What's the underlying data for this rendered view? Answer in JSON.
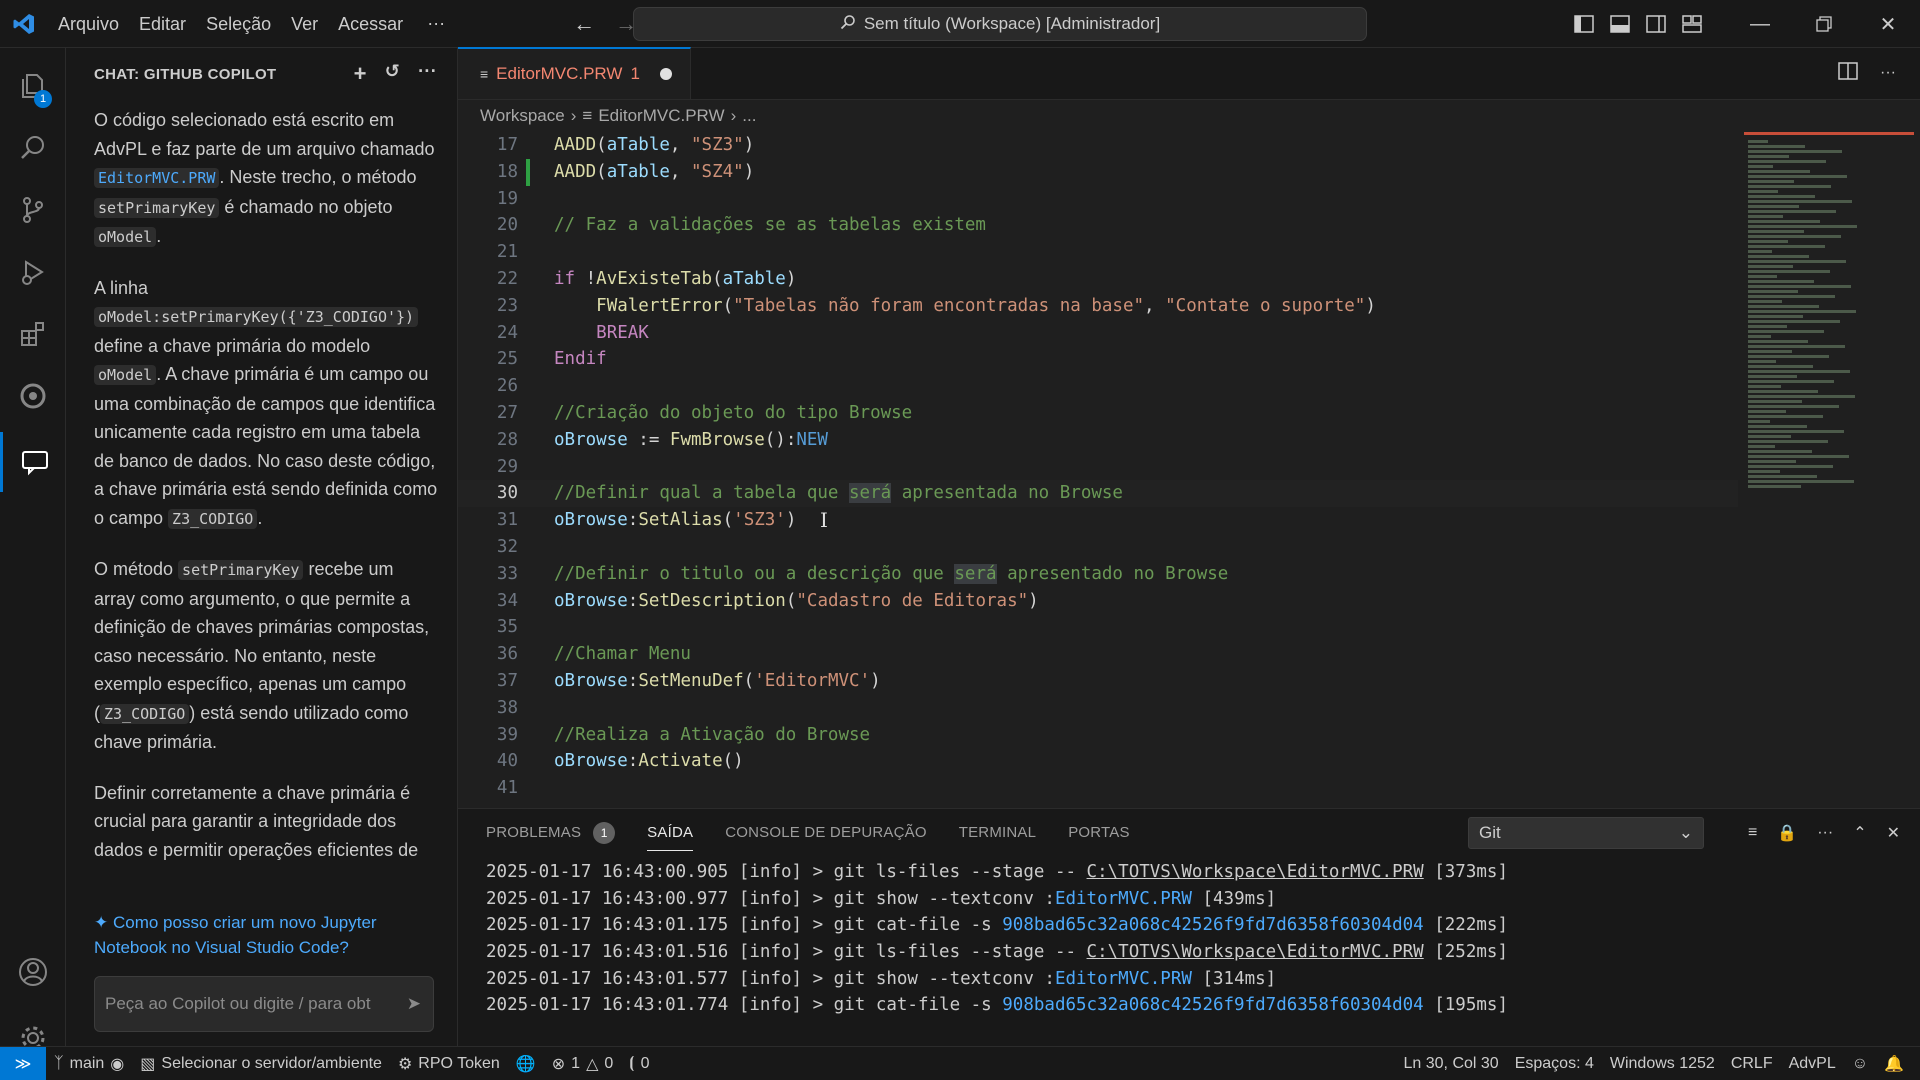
{
  "menu": {
    "items": [
      "Arquivo",
      "Editar",
      "Seleção",
      "Ver",
      "Acessar"
    ],
    "more": "···"
  },
  "command_center": {
    "label": "Sem título (Workspace) [Administrador]"
  },
  "activity": {
    "explorer_badge": "1"
  },
  "chat": {
    "header": "CHAT: GITHUB COPILOT",
    "p1": {
      "a": "O código selecionado está escrito em AdvPL e faz parte de um arquivo chamado ",
      "file": "EditorMVC.PRW",
      "b": ". Neste trecho, o método ",
      "method": "setPrimaryKey",
      "c": " é chamado no objeto ",
      "obj": "oModel",
      "d": "."
    },
    "p2": {
      "a": "A linha ",
      "code": "oModel:setPrimaryKey({'Z3_CODIGO'})",
      "b": " define a chave primária do modelo ",
      "obj": "oModel",
      "c": ". A chave primária é um campo ou uma combinação de campos que identifica unicamente cada registro em uma tabela de banco de dados. No caso deste código, a chave primária está sendo definida como o campo ",
      "field": "Z3_CODIGO",
      "d": "."
    },
    "p3": {
      "a": "O método ",
      "method": "setPrimaryKey",
      "b": " recebe um array como argumento, o que permite a definição de chaves primárias compostas, caso necessário. No entanto, neste exemplo específico, apenas um campo (",
      "field": "Z3_CODIGO",
      "c": ") está sendo utilizado como chave primária."
    },
    "p4": "Definir corretamente a chave primária é crucial para garantir a integridade dos dados e permitir operações eficientes de",
    "suggestion": "Como posso criar um novo Jupyter Notebook no Visual Studio Code?",
    "input_placeholder": "Peça ao Copilot ou digite / para obt"
  },
  "editor": {
    "tab": {
      "label": "EditorMVC.PRW",
      "problems": "1"
    },
    "breadcrumb": [
      "Workspace",
      "EditorMVC.PRW",
      "..."
    ]
  },
  "code_lines": [
    {
      "n": "17",
      "tokens": [
        [
          "fn",
          "AADD"
        ],
        [
          "p",
          "("
        ],
        [
          "var",
          "aTable"
        ],
        [
          "p",
          ", "
        ],
        [
          "str",
          "\"SZ3\""
        ],
        [
          "p",
          ")"
        ]
      ]
    },
    {
      "n": "18",
      "tokens": [
        [
          "fn",
          "AADD"
        ],
        [
          "p",
          "("
        ],
        [
          "var",
          "aTable"
        ],
        [
          "p",
          ", "
        ],
        [
          "str",
          "\"SZ4\""
        ],
        [
          "p",
          ")"
        ]
      ]
    },
    {
      "n": "19",
      "tokens": []
    },
    {
      "n": "20",
      "tokens": [
        [
          "cmt",
          "// Faz a validações se as tabelas existem"
        ]
      ]
    },
    {
      "n": "21",
      "tokens": []
    },
    {
      "n": "22",
      "tokens": [
        [
          "kw",
          "if"
        ],
        [
          "p",
          " !"
        ],
        [
          "fn",
          "AvExisteTab"
        ],
        [
          "p",
          "("
        ],
        [
          "var",
          "aTable"
        ],
        [
          "p",
          ")"
        ]
      ]
    },
    {
      "n": "23",
      "tokens": [
        [
          "p",
          "    "
        ],
        [
          "fn",
          "FWalertError"
        ],
        [
          "p",
          "("
        ],
        [
          "str",
          "\"Tabelas não foram encontradas na base\""
        ],
        [
          "p",
          ", "
        ],
        [
          "str",
          "\"Contate o suporte\""
        ],
        [
          "p",
          ")"
        ]
      ]
    },
    {
      "n": "24",
      "tokens": [
        [
          "p",
          "    "
        ],
        [
          "kw",
          "BREAK"
        ]
      ]
    },
    {
      "n": "25",
      "tokens": [
        [
          "kw",
          "Endif"
        ]
      ]
    },
    {
      "n": "26",
      "tokens": []
    },
    {
      "n": "27",
      "tokens": [
        [
          "cmt",
          "//Criação do objeto do tipo Browse"
        ]
      ]
    },
    {
      "n": "28",
      "tokens": [
        [
          "var",
          "oBrowse"
        ],
        [
          "p",
          " := "
        ],
        [
          "fn",
          "FwmBrowse"
        ],
        [
          "p",
          "():"
        ],
        [
          "k2",
          "NEW"
        ]
      ]
    },
    {
      "n": "29",
      "tokens": []
    },
    {
      "n": "30",
      "tokens": [
        [
          "cmt",
          "//Definir qual a tabela que "
        ],
        [
          "cmthl",
          "será"
        ],
        [
          "cmt",
          " apresentada no Browse"
        ]
      ]
    },
    {
      "n": "31",
      "tokens": [
        [
          "var",
          "oBrowse"
        ],
        [
          "p",
          ":"
        ],
        [
          "fn",
          "SetAlias"
        ],
        [
          "p",
          "("
        ],
        [
          "str",
          "'SZ3'"
        ],
        [
          "p",
          ")"
        ]
      ]
    },
    {
      "n": "32",
      "tokens": []
    },
    {
      "n": "33",
      "tokens": [
        [
          "cmt",
          "//Definir o titulo ou a descrição que "
        ],
        [
          "cmthl",
          "será"
        ],
        [
          "cmt",
          " apresentado no Browse"
        ]
      ]
    },
    {
      "n": "34",
      "tokens": [
        [
          "var",
          "oBrowse"
        ],
        [
          "p",
          ":"
        ],
        [
          "fn",
          "SetDescription"
        ],
        [
          "p",
          "("
        ],
        [
          "str",
          "\"Cadastro de Editoras\""
        ],
        [
          "p",
          ")"
        ]
      ]
    },
    {
      "n": "35",
      "tokens": []
    },
    {
      "n": "36",
      "tokens": [
        [
          "cmt",
          "//Chamar Menu"
        ]
      ]
    },
    {
      "n": "37",
      "tokens": [
        [
          "var",
          "oBrowse"
        ],
        [
          "p",
          ":"
        ],
        [
          "fn",
          "SetMenuDef"
        ],
        [
          "p",
          "("
        ],
        [
          "str",
          "'EditorMVC'"
        ],
        [
          "p",
          ")"
        ]
      ]
    },
    {
      "n": "38",
      "tokens": []
    },
    {
      "n": "39",
      "tokens": [
        [
          "cmt",
          "//Realiza a Ativação do Browse"
        ]
      ]
    },
    {
      "n": "40",
      "tokens": [
        [
          "var",
          "oBrowse"
        ],
        [
          "p",
          ":"
        ],
        [
          "fn",
          "Activate"
        ],
        [
          "p",
          "()"
        ]
      ]
    },
    {
      "n": "41",
      "tokens": []
    }
  ],
  "panel": {
    "tabs": [
      "PROBLEMAS",
      "SAÍDA",
      "CONSOLE DE DEPURAÇÃO",
      "TERMINAL",
      "PORTAS"
    ],
    "problems_count": "1",
    "channel": "Git",
    "output": [
      {
        "pre": "2025-01-17 16:43:00.905 [info] > git ls-files --stage -- ",
        "ref": "C:\\TOTVS\\Workspace\\EditorMVC.PRW",
        "kind": "path",
        "post": " [373ms]"
      },
      {
        "pre": "2025-01-17 16:43:00.977 [info] > git show --textconv :",
        "ref": "EditorMVC.PRW",
        "kind": "link",
        "post": " [439ms]"
      },
      {
        "pre": "2025-01-17 16:43:01.175 [info] > git cat-file -s ",
        "ref": "908bad65c32a068c42526f9fd7d6358f60304d04",
        "kind": "link",
        "post": " [222ms]"
      },
      {
        "pre": "2025-01-17 16:43:01.516 [info] > git ls-files --stage -- ",
        "ref": "C:\\TOTVS\\Workspace\\EditorMVC.PRW",
        "kind": "path",
        "post": " [252ms]"
      },
      {
        "pre": "2025-01-17 16:43:01.577 [info] > git show --textconv :",
        "ref": "EditorMVC.PRW",
        "kind": "link",
        "post": " [314ms]"
      },
      {
        "pre": "2025-01-17 16:43:01.774 [info] > git cat-file -s ",
        "ref": "908bad65c32a068c42526f9fd7d6358f60304d04",
        "kind": "link",
        "post": " [195ms]"
      }
    ]
  },
  "status": {
    "branch": "main",
    "server": "Selecionar o servidor/ambiente",
    "rpo": "RPO Token",
    "errors": "1",
    "warnings": "0",
    "ports": "0",
    "position": "Ln 30, Col 30",
    "spaces": "Espaços: 4",
    "encoding": "Windows 1252",
    "eol": "CRLF",
    "language": "AdvPL"
  }
}
